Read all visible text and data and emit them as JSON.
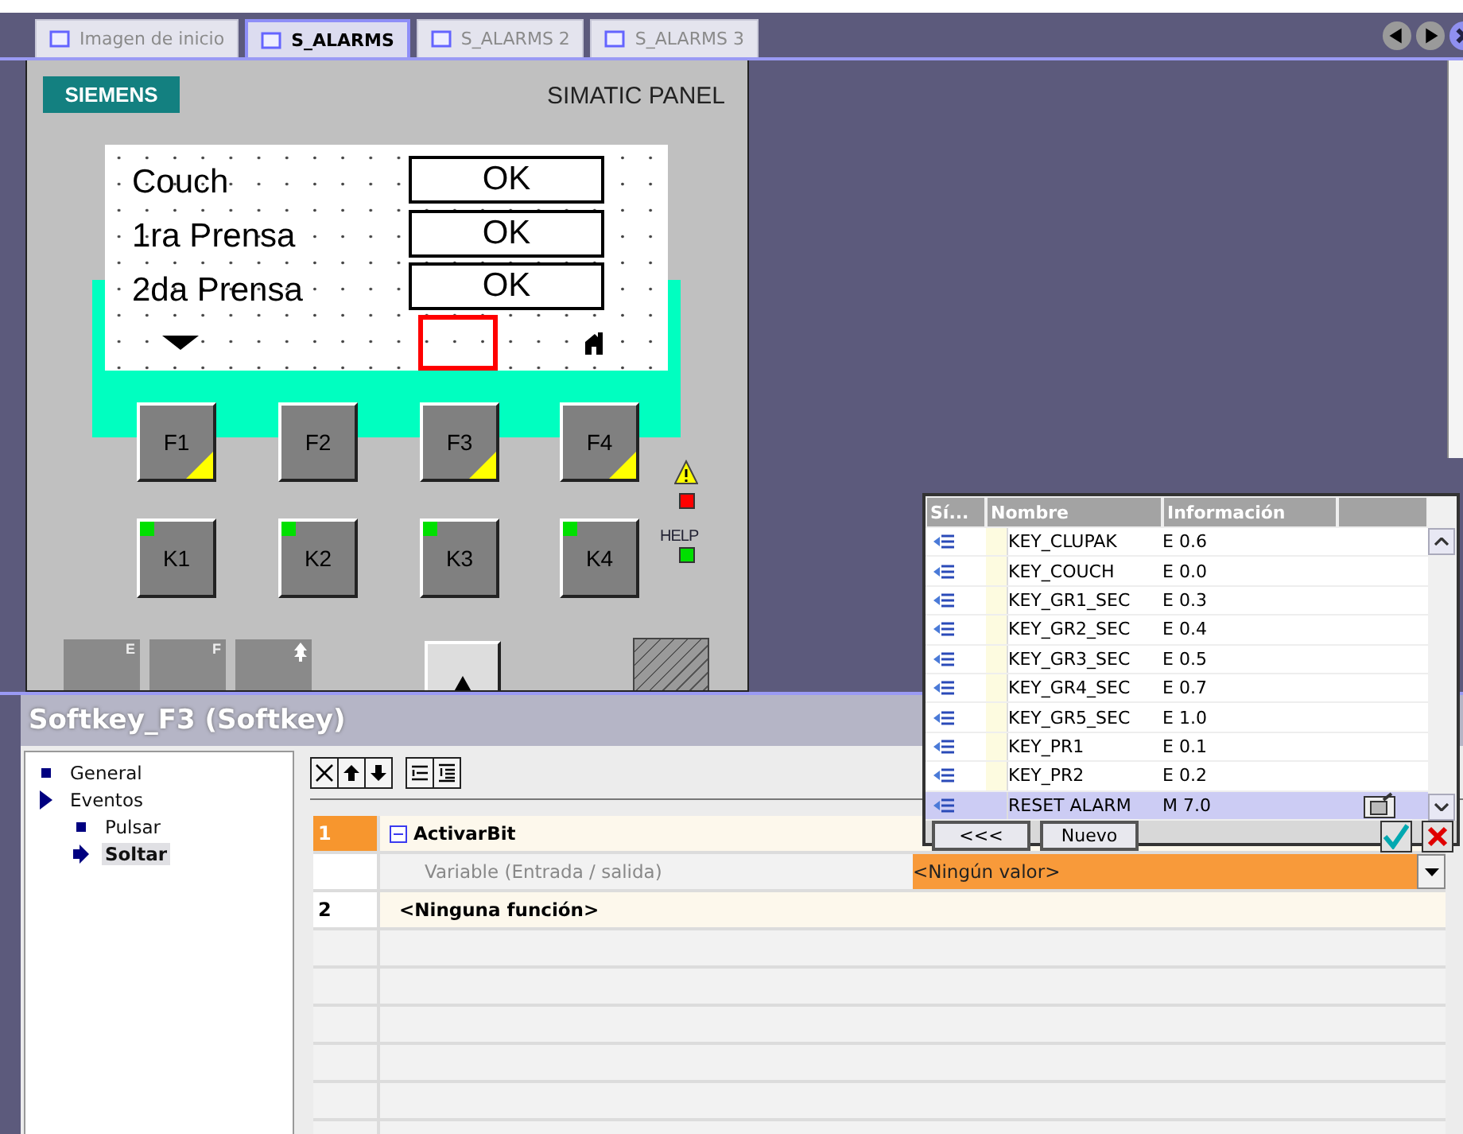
{
  "tabs": [
    {
      "label": "Imagen de inicio",
      "selected": false
    },
    {
      "label": "S_ALARMS",
      "selected": true
    },
    {
      "label": "S_ALARMS 2",
      "selected": false
    },
    {
      "label": "S_ALARMS 3",
      "selected": false
    }
  ],
  "panel": {
    "logo": "SIEMENS",
    "title": "SIMATIC PANEL",
    "display_rows": [
      {
        "label": "Couch",
        "value": "OK"
      },
      {
        "label": "1ra Prensa",
        "value": "OK"
      },
      {
        "label": "2da Prensa",
        "value": "OK"
      }
    ],
    "function_keys": [
      {
        "label": "F1",
        "assigned": true
      },
      {
        "label": "F2",
        "assigned": false
      },
      {
        "label": "F3",
        "assigned": true
      },
      {
        "label": "F4",
        "assigned": true
      }
    ],
    "keys": [
      {
        "label": "K1",
        "led": true
      },
      {
        "label": "K2",
        "led": true
      },
      {
        "label": "K3",
        "led": true
      },
      {
        "label": "K4",
        "led": true
      }
    ],
    "help_label": "HELP",
    "bottom_keys": [
      {
        "kind": "digit",
        "sublabel": "E"
      },
      {
        "kind": "digit",
        "sublabel": "F"
      },
      {
        "kind": "digit-shift"
      },
      {
        "kind": "arrow-up"
      },
      {
        "kind": "hatched"
      }
    ]
  },
  "properties": {
    "title": "Softkey_F3 (Softkey)",
    "tree": [
      {
        "label": "General",
        "selected": false
      },
      {
        "label": "Eventos",
        "selected": false,
        "children": [
          {
            "label": "Pulsar",
            "selected": false
          },
          {
            "label": "Soltar",
            "selected": true
          }
        ]
      }
    ],
    "function_list": [
      {
        "kind": "function",
        "number": "1",
        "name": "ActivarBit",
        "expanded": true,
        "selected": true
      },
      {
        "kind": "parameter",
        "name": "Variable (Entrada / salida)",
        "value": "<Ningún valor>"
      },
      {
        "kind": "function",
        "number": "2",
        "name": "<Ninguna función>",
        "selected": false
      }
    ]
  },
  "tag_picker": {
    "columns": [
      "Sí...",
      "Nombre",
      "Información"
    ],
    "rows": [
      {
        "name": "KEY_CLUPAK",
        "info": "E 0.6",
        "selected": false
      },
      {
        "name": "KEY_COUCH",
        "info": "E 0.0",
        "selected": false
      },
      {
        "name": "KEY_GR1_SEC",
        "info": "E 0.3",
        "selected": false
      },
      {
        "name": "KEY_GR2_SEC",
        "info": "E 0.4",
        "selected": false
      },
      {
        "name": "KEY_GR3_SEC",
        "info": "E 0.5",
        "selected": false
      },
      {
        "name": "KEY_GR4_SEC",
        "info": "E 0.7",
        "selected": false
      },
      {
        "name": "KEY_GR5_SEC",
        "info": "E 1.0",
        "selected": false
      },
      {
        "name": "KEY_PR1",
        "info": "E 0.1",
        "selected": false
      },
      {
        "name": "KEY_PR2",
        "info": "E 0.2",
        "selected": false
      },
      {
        "name": "RESET ALARM",
        "info": "M 7.0",
        "selected": true
      }
    ],
    "buttons": [
      "<<<",
      "Nuevo"
    ]
  }
}
